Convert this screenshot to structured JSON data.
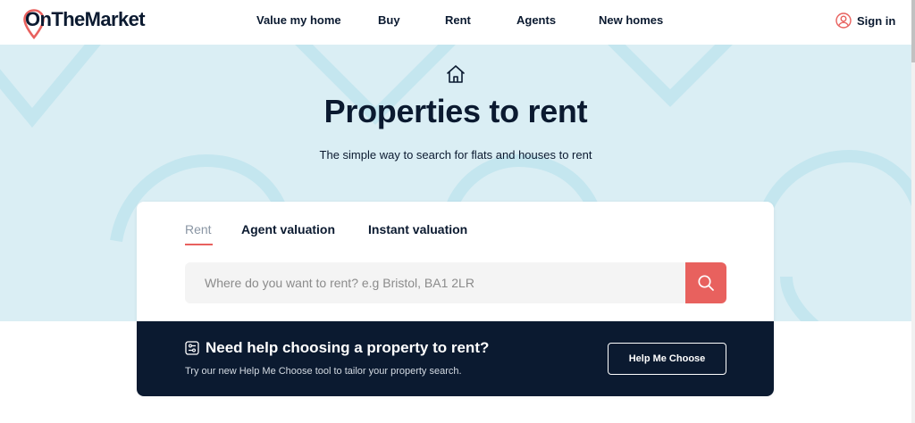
{
  "brand": {
    "logo_text": "OnTheMarket",
    "accent_color": "#e8615e",
    "navy_color": "#0b1a30"
  },
  "nav": {
    "items": [
      {
        "label": "Value my home"
      },
      {
        "label": "Buy"
      },
      {
        "label": "Rent"
      },
      {
        "label": "Agents"
      },
      {
        "label": "New homes"
      }
    ],
    "signin_label": "Sign in",
    "signin_icon": "user-circle-icon"
  },
  "hero": {
    "icon": "house-icon",
    "title": "Properties to rent",
    "subtitle": "The simple way to search for flats and houses to rent",
    "background_color": "#daeef4"
  },
  "search_card": {
    "tabs": [
      {
        "label": "Rent",
        "active": true
      },
      {
        "label": "Agent valuation",
        "active": false
      },
      {
        "label": "Instant valuation",
        "active": false
      }
    ],
    "search_placeholder": "Where do you want to rent? e.g Bristol, BA1 2LR",
    "search_value": "",
    "search_icon": "search-icon"
  },
  "help_banner": {
    "icon": "sliders-icon",
    "title": "Need help choosing a property to rent?",
    "subtitle": "Try our new Help Me Choose tool to tailor your property search.",
    "button_label": "Help Me Choose"
  }
}
